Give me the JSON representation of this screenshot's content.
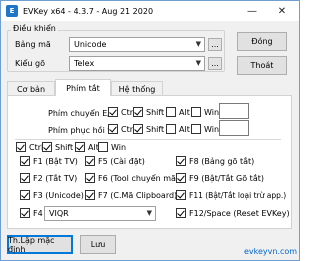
{
  "window": {
    "title": "EVKey x64 - 4.3.7 - Aug 21 2020",
    "icon_label": "E",
    "minimize_glyph": "—",
    "close_glyph": "✕"
  },
  "control": {
    "group_title": "Điều khiển",
    "bang_ma_label": "Bảng mã",
    "bang_ma_value": "Unicode",
    "kieu_go_label": "Kiểu gõ",
    "kieu_go_value": "Telex",
    "ellipsis": "...",
    "dong_button": "Đóng",
    "thoat_button": "Thoát"
  },
  "tabs": [
    {
      "label": "Cơ bản",
      "active": false
    },
    {
      "label": "Phím tắt",
      "active": true
    },
    {
      "label": "Hệ thống",
      "active": false
    }
  ],
  "hotkeys": {
    "switch_label": "Phím chuyển E/V",
    "restore_label": "Phím phục hồi từ",
    "modifiers": {
      "ctrl": "Ctrl",
      "shift": "Shift",
      "alt": "Alt",
      "win": "Win"
    },
    "switch_state": {
      "ctrl": true,
      "shift": true,
      "alt": false,
      "win": false
    },
    "restore_state": {
      "ctrl": true,
      "shift": true,
      "alt": false,
      "win": false
    },
    "global_state": {
      "ctrl": true,
      "shift": true,
      "alt": true,
      "win": false
    }
  },
  "fkeys": [
    {
      "label": "F1 (Bật TV)",
      "checked": true
    },
    {
      "label": "F2 (Tắt TV)",
      "checked": true
    },
    {
      "label": "F3 (Unicode)",
      "checked": true
    },
    {
      "label": "F4",
      "checked": true
    },
    {
      "label": "F5 (Cài đặt)",
      "checked": true
    },
    {
      "label": "F6 (Tool chuyển mã)",
      "checked": true
    },
    {
      "label": "F7 (C.Mã Clipboard)",
      "checked": true
    },
    {
      "label": "F8 (Bảng gõ tắt)",
      "checked": true
    },
    {
      "label": "F9 (Bật/Tắt Gõ tắt)",
      "checked": true
    },
    {
      "label": "F11 (Bật/Tắt loại trừ app.)",
      "checked": true
    },
    {
      "label": "F12/Space (Reset EVKey)",
      "checked": true
    }
  ],
  "f4_select_value": "VIQR",
  "footer": {
    "default_button": "Th.Lập mặc định",
    "save_button": "Lưu",
    "website": "evkeyvn.com"
  }
}
